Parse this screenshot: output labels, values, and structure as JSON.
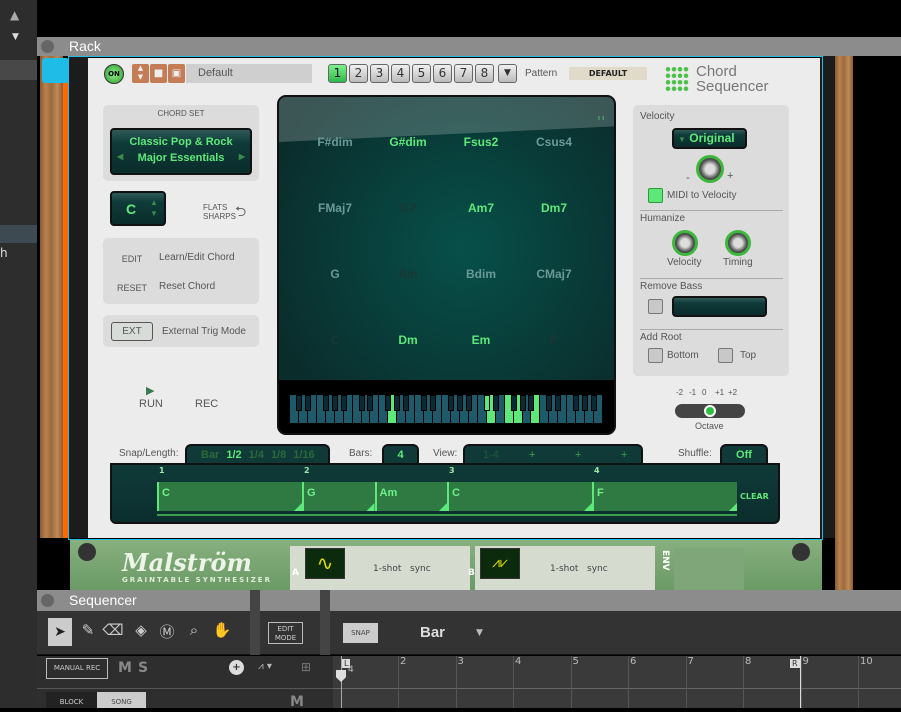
{
  "sidebar": {
    "partial_label": "h"
  },
  "rack": {
    "title": "Rack"
  },
  "device": {
    "power_label": "ON",
    "patch_name": "Default",
    "patterns": [
      "1",
      "2",
      "3",
      "4",
      "5",
      "6",
      "7",
      "8"
    ],
    "active_pattern": "1",
    "pattern_label": "Pattern",
    "pattern_name": "DEFAULT",
    "logo_line1": "Chord",
    "logo_line2": "Sequencer",
    "chord_set": {
      "label": "CHORD SET",
      "line1": "Classic Pop & Rock",
      "line2": "Major Essentials"
    },
    "key": "C",
    "flats_label": "FLATS",
    "sharps_label": "SHARPS",
    "edit": {
      "button": "EDIT",
      "label": "Learn/Edit Chord"
    },
    "reset": {
      "button": "RESET",
      "label": "Reset Chord"
    },
    "ext": {
      "button": "EXT",
      "label": "External Trig Mode"
    },
    "run_label": "RUN",
    "rec_label": "REC",
    "chords": [
      [
        {
          "name": "F#dim",
          "state": "mid"
        },
        {
          "name": "G#dim",
          "state": "bright"
        },
        {
          "name": "Fsus2",
          "state": "bright"
        },
        {
          "name": "Csus4",
          "state": "mid"
        }
      ],
      [
        {
          "name": "FMaj7",
          "state": "mid"
        },
        {
          "name": "G7",
          "state": "dark"
        },
        {
          "name": "Am7",
          "state": "bright"
        },
        {
          "name": "Dm7",
          "state": "bright"
        }
      ],
      [
        {
          "name": "G",
          "state": "mid"
        },
        {
          "name": "Am",
          "state": "dark"
        },
        {
          "name": "Bdim",
          "state": "mid"
        },
        {
          "name": "CMaj7",
          "state": "mid"
        }
      ],
      [
        {
          "name": "C",
          "state": "dark"
        },
        {
          "name": "Dm",
          "state": "bright"
        },
        {
          "name": "Em",
          "state": "bright"
        },
        {
          "name": "F",
          "state": "dark"
        }
      ]
    ],
    "keyboard": {
      "white_keys": 35,
      "lit_white_keys": [
        11,
        22,
        24,
        25,
        27
      ],
      "lit_black_keys": [
        15
      ]
    },
    "velocity": {
      "label": "Velocity",
      "mode": "Original",
      "minus": "-",
      "plus": "+",
      "midi_label": "MIDI to Velocity",
      "midi_on": true
    },
    "humanize": {
      "label": "Humanize",
      "velocity": "Velocity",
      "timing": "Timing"
    },
    "remove_bass": {
      "label": "Remove Bass"
    },
    "add_root": {
      "label": "Add Root",
      "bottom": "Bottom",
      "top": "Top"
    },
    "octave": {
      "label": "Octave",
      "ticks": [
        "-2",
        "-1",
        "0",
        "+1",
        "+2"
      ],
      "value": "0"
    },
    "snap": {
      "label": "Snap/Length:",
      "options": [
        "Bar",
        "1/2",
        "1/4",
        "1/8",
        "1/16"
      ],
      "selected": "1/2"
    },
    "bars": {
      "label": "Bars:",
      "value": "4"
    },
    "view": {
      "label": "View:",
      "options": [
        "1-4",
        "+",
        "+",
        "+"
      ]
    },
    "shuffle": {
      "label": "Shuffle:",
      "value": "Off"
    },
    "lane": {
      "bar_numbers": [
        "1",
        "2",
        "3",
        "4"
      ],
      "clear_label": "CLEAR",
      "events": [
        {
          "chord": "C",
          "start": 1,
          "length": 1
        },
        {
          "chord": "G",
          "start": 2,
          "length": 0.5
        },
        {
          "chord": "Am",
          "start": 2.5,
          "length": 0.5
        },
        {
          "chord": "C",
          "start": 3,
          "length": 1
        },
        {
          "chord": "F",
          "start": 4,
          "length": 1
        }
      ]
    }
  },
  "malstrom": {
    "name": "Malström",
    "subtitle": "GRAINTABLE SYNTHESIZER",
    "osc_a": "A",
    "osc_b": "B",
    "oneshot": "1-shot",
    "sync": "sync",
    "env": "ENV"
  },
  "sequencer": {
    "title": "Sequencer",
    "tools": [
      "select",
      "pencil",
      "eraser",
      "razor",
      "mute",
      "magnify",
      "hand"
    ],
    "edit_mode": "EDIT MODE",
    "snap_button": "SNAP",
    "snap_value": "Bar",
    "manual_rec": "MANUAL REC",
    "m": "M",
    "s": "S",
    "block": "BLOCK",
    "song": "SONG",
    "track_m": "M",
    "ruler": [
      "2",
      "3",
      "4",
      "5",
      "6",
      "7",
      "8",
      "9",
      "10"
    ],
    "left_locator": "L",
    "right_locator": "R",
    "loop_start_label": "4"
  }
}
